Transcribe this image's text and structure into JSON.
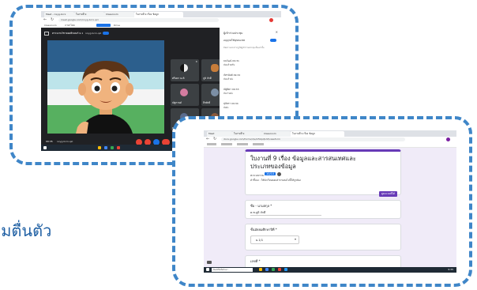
{
  "accent": "#3f86c8",
  "subtitle": "ามตื่นตัว",
  "meet_window": {
    "tabs": [
      {
        "label": "Meet - nxyg-bcrx"
      },
      {
        "label": "ใบงานที่ 9"
      },
      {
        "label": "Classroom"
      },
      {
        "label": "ใบงานที่ 9 เรื่อง ข้อมูล"
      }
    ],
    "url": "meet.google.com/nxyg-bcrx-qzi",
    "bookmarks": [
      {
        "label": "Classroom"
      },
      {
        "label": "ภาษาไทย"
      },
      {
        "label": "Google Forms"
      },
      {
        "label": "Drive"
      }
    ],
    "meeting_title": "ตรวจงานวิชาคอมพิวเตอร์ ม.1",
    "meeting_info": "nxyg-bcrx-qzi",
    "participant_tiles": [
      {
        "name": "ศรีมดา มะลิ"
      },
      {
        "name": "ภูมิ ภักดี"
      },
      {
        "name": "ณัฐกานต์"
      },
      {
        "name": "ธีรศักดิ์"
      },
      {
        "name": "Ramapati Hemdi"
      },
      {
        "name": "อภิศักดิ์"
      }
    ],
    "meeting_code_footer": "nxyg-bcrx-qzi",
    "time": "09:35",
    "side_panel": {
      "title": "ผู้เข้าร่วมประชุม",
      "toggle_label": "อนุญาตให้ทุกคนแชท",
      "notice": "ข้อความจะปรากฏให้ผู้เข้าร่วมประชุมเห็นเท่านั้น",
      "messages": [
        {
          "author": "ธนวัฒน์ 09:31",
          "text": "ส่งแล้วครับ"
        },
        {
          "author": "ภัทรนันท์ 09:32",
          "text": "ส่งแล้วค่ะ"
        },
        {
          "author": "ณัฐธิดา 09:33",
          "text": "ส่งงานค่ะ"
        },
        {
          "author": "สุภัทรา 09:34",
          "text": "ส่งค่ะ"
        }
      ]
    }
  },
  "form_window": {
    "tabs": [
      {
        "label": "Meet"
      },
      {
        "label": "ใบงานที่ 9"
      },
      {
        "label": "Classroom"
      },
      {
        "label": "ใบงานที่ 9 เรื่อง ข้อมูล"
      }
    ],
    "url": "docs.google.com/forms/d/e/1FAIpQLSf/viewform",
    "form_title": "ใบงานที่ 9 เรื่อง ข้อมูลและสารสนเทศและประเภทของข้อมูล",
    "points_label": "คะแนนรวม",
    "points_value": "10/10",
    "description": "คำชี้แจง : ให้นักเรียนตอบคำถามต่อไปนี้ให้ถูกต้อง",
    "view_score_button": "ดูคะแนนที่ได้",
    "questions": [
      {
        "label": "ชื่อ - นามสกุล *",
        "answer": "ด.ช.ภูมิ ภักดี"
      },
      {
        "label": "ชั้นมัธยมศึกษาปีที่ *",
        "answer": "ม.1/1"
      },
      {
        "label": "เลขที่ *",
        "answer": ""
      }
    ],
    "taskbar_search": "พิมพ์ที่นี่เพื่อค้นหา",
    "time": "9:35"
  }
}
